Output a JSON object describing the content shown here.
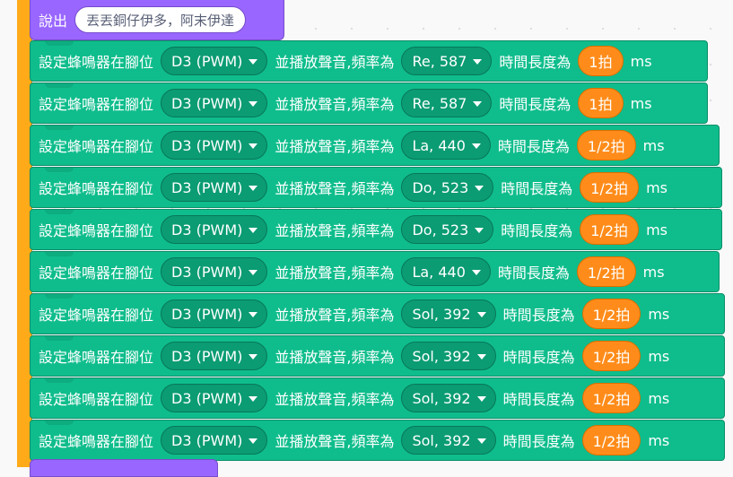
{
  "say_block": {
    "label": "說出",
    "message": "丟丟銅仔伊多，阿末伊達"
  },
  "buzzer_blocks": [
    {
      "prefix": "設定蜂鳴器在腳位",
      "pin": "D3 (PWM)",
      "middle": "並播放聲音,頻率為",
      "note": "Re, 587",
      "duration_label": "時間長度為",
      "beat": "1拍",
      "unit": "ms"
    },
    {
      "prefix": "設定蜂鳴器在腳位",
      "pin": "D3 (PWM)",
      "middle": "並播放聲音,頻率為",
      "note": "Re, 587",
      "duration_label": "時間長度為",
      "beat": "1拍",
      "unit": "ms"
    },
    {
      "prefix": "設定蜂鳴器在腳位",
      "pin": "D3 (PWM)",
      "middle": "並播放聲音,頻率為",
      "note": "La, 440",
      "duration_label": "時間長度為",
      "beat": "1/2拍",
      "unit": "ms"
    },
    {
      "prefix": "設定蜂鳴器在腳位",
      "pin": "D3 (PWM)",
      "middle": "並播放聲音,頻率為",
      "note": "Do, 523",
      "duration_label": "時間長度為",
      "beat": "1/2拍",
      "unit": "ms"
    },
    {
      "prefix": "設定蜂鳴器在腳位",
      "pin": "D3 (PWM)",
      "middle": "並播放聲音,頻率為",
      "note": "Do, 523",
      "duration_label": "時間長度為",
      "beat": "1/2拍",
      "unit": "ms"
    },
    {
      "prefix": "設定蜂鳴器在腳位",
      "pin": "D3 (PWM)",
      "middle": "並播放聲音,頻率為",
      "note": "La, 440",
      "duration_label": "時間長度為",
      "beat": "1/2拍",
      "unit": "ms"
    },
    {
      "prefix": "設定蜂鳴器在腳位",
      "pin": "D3 (PWM)",
      "middle": "並播放聲音,頻率為",
      "note": "Sol, 392",
      "duration_label": "時間長度為",
      "beat": "1/2拍",
      "unit": "ms"
    },
    {
      "prefix": "設定蜂鳴器在腳位",
      "pin": "D3 (PWM)",
      "middle": "並播放聲音,頻率為",
      "note": "Sol, 392",
      "duration_label": "時間長度為",
      "beat": "1/2拍",
      "unit": "ms"
    },
    {
      "prefix": "設定蜂鳴器在腳位",
      "pin": "D3 (PWM)",
      "middle": "並播放聲音,頻率為",
      "note": "Sol, 392",
      "duration_label": "時間長度為",
      "beat": "1/2拍",
      "unit": "ms"
    },
    {
      "prefix": "設定蜂鳴器在腳位",
      "pin": "D3 (PWM)",
      "middle": "並播放聲音,頻率為",
      "note": "Sol, 392",
      "duration_label": "時間長度為",
      "beat": "1/2拍",
      "unit": "ms"
    }
  ],
  "colors": {
    "looks_block": "#9966ff",
    "control_rail": "#ffab19",
    "extension_block": "#0fbd8c",
    "dropdown": "#0b9c73",
    "beat_reporter": "#ff8c1a"
  }
}
